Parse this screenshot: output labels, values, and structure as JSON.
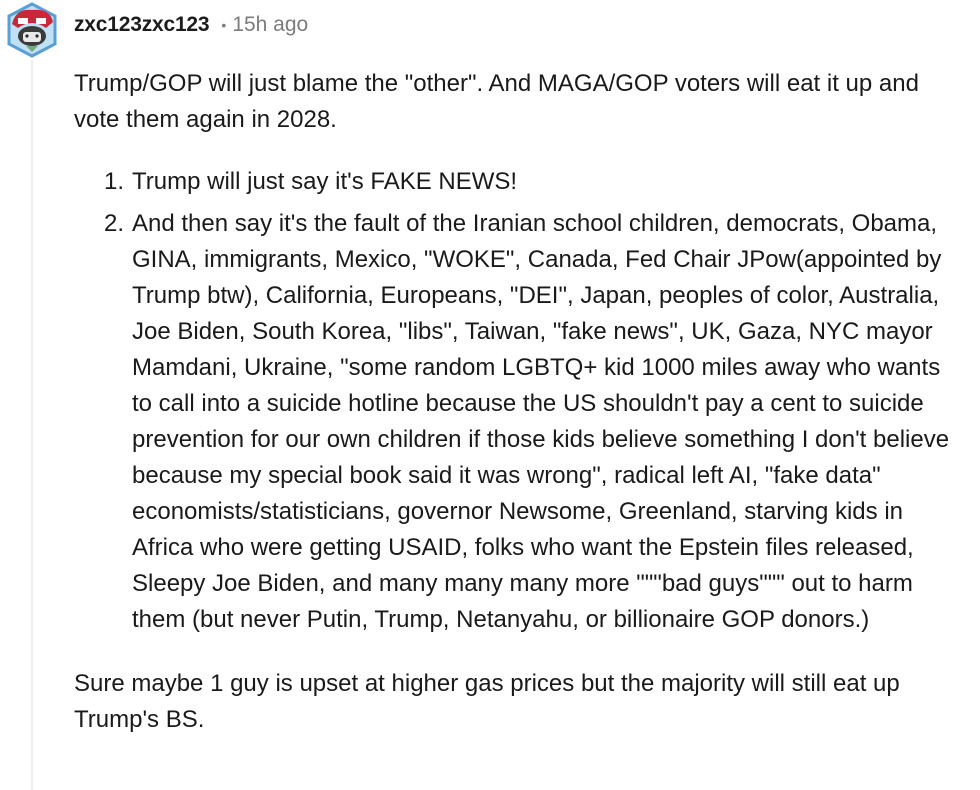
{
  "comment": {
    "username": "zxc123zxc123",
    "dot": "•",
    "timestamp": "15h ago",
    "paragraph_1": "Trump/GOP will just blame the \"other\". And MAGA/GOP voters will eat it up and vote them again in 2028.",
    "list": [
      {
        "number": "1.",
        "text": "Trump will just say it's FAKE NEWS!"
      },
      {
        "number": "2.",
        "text": "And then say it's the fault of the Iranian school children, democrats, Obama, GINA, immigrants, Mexico, \"WOKE\", Canada, Fed Chair JPow(appointed by Trump btw), California, Europeans, \"DEI\", Japan, peoples of color, Australia, Joe Biden, South Korea, \"libs\", Taiwan, \"fake news\", UK, Gaza, NYC mayor Mamdani, Ukraine, \"some random LGBTQ+ kid 1000 miles away who wants to call into a suicide hotline because the US shouldn't pay a cent to suicide prevention for our own children if those kids believe something I don't believe because my special book said it was wrong\", radical left AI, \"fake data\" economists/statisticians, governor Newsome, Greenland, starving kids in Africa who were getting USAID, folks who want the Epstein files released, Sleepy Joe Biden, and many many many more \"\"\"bad guys\"\"\" out to harm them (but never Putin, Trump, Netanyahu, or billionaire GOP donors.)"
      }
    ],
    "paragraph_2": "Sure maybe 1 guy is upset at higher gas prices but the majority will still eat up Trump's BS."
  },
  "avatar": {
    "icon": "snoo-avatar-icon",
    "colors": {
      "hex_outline": "#5a9fd4",
      "hex_fill": "#bfe0f5",
      "hat": "#c8283a",
      "face": "#2b2b2b"
    }
  },
  "colors": {
    "text": "#1a1a1b",
    "meta": "#7c7c7c",
    "thread_line": "#ededed"
  }
}
